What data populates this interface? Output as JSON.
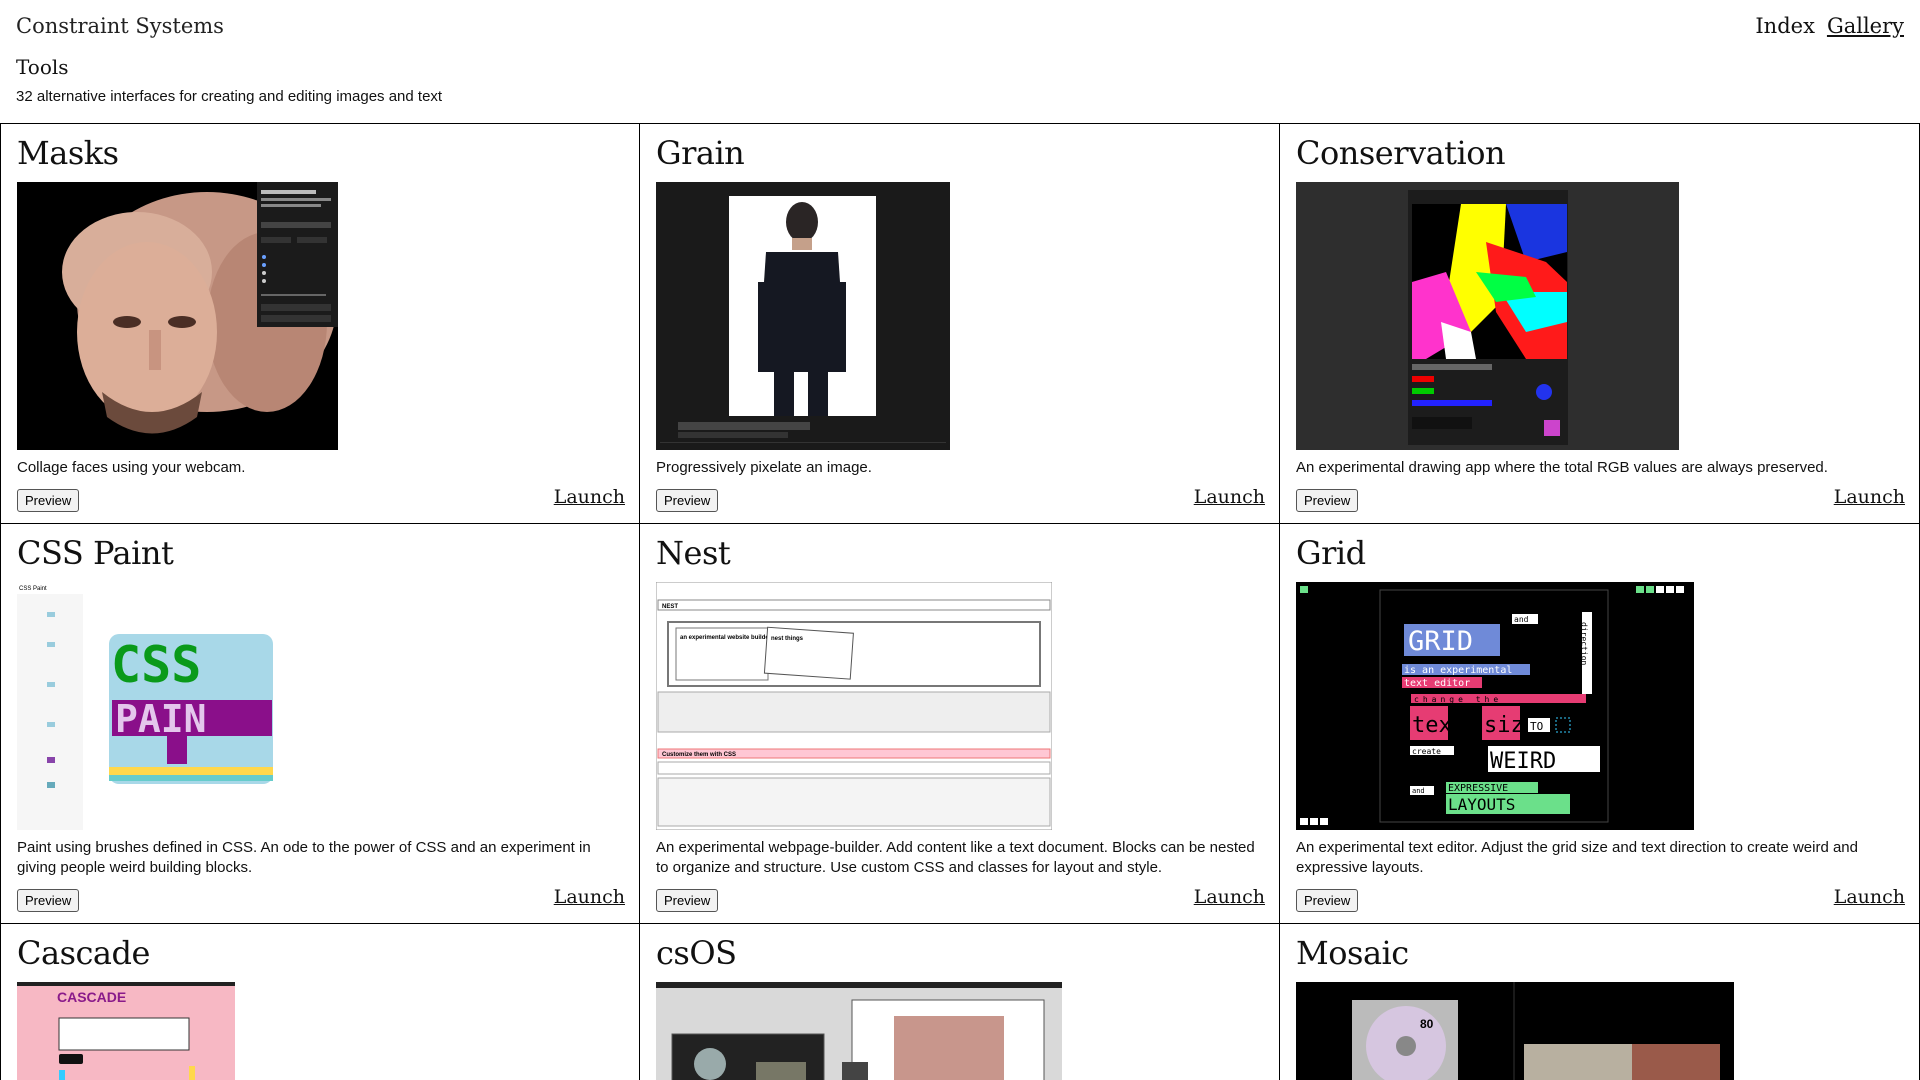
{
  "site": {
    "title": "Constraint Systems"
  },
  "nav": {
    "index": "Index",
    "gallery": "Gallery"
  },
  "section": {
    "title": "Tools",
    "subtitle": "32 alternative interfaces for creating and editing images and text"
  },
  "cards": [
    {
      "title": "Masks",
      "desc": "Collage faces using your webcam.",
      "preview": "Preview",
      "launch": "Launch"
    },
    {
      "title": "Grain",
      "desc": "Progressively pixelate an image.",
      "preview": "Preview",
      "launch": "Launch"
    },
    {
      "title": "Conservation",
      "desc": "An experimental drawing app where the total RGB values are always preserved.",
      "preview": "Preview",
      "launch": "Launch"
    },
    {
      "title": "CSS Paint",
      "desc": "Paint using brushes defined in CSS. An ode to the power of CSS and an experiment in giving people weird building blocks.",
      "preview": "Preview",
      "launch": "Launch"
    },
    {
      "title": "Nest",
      "desc": "An experimental webpage-builder. Add content like a text document. Blocks can be nested to organize and structure. Use custom CSS and classes for layout and style.",
      "preview": "Preview",
      "launch": "Launch"
    },
    {
      "title": "Grid",
      "desc": "An experimental text editor. Adjust the grid size and text direction to create weird and expressive layouts.",
      "preview": "Preview",
      "launch": "Launch"
    },
    {
      "title": "Cascade"
    },
    {
      "title": "csOS"
    },
    {
      "title": "Mosaic"
    }
  ],
  "thumb_text": {
    "grid_word1": "GRID",
    "grid_word2": "is an experimental",
    "grid_word3": "text editor",
    "grid_word4": "text",
    "grid_word5": "size",
    "grid_word6": "TO",
    "grid_word7": "WEIRD",
    "grid_word8": "EXPRESSIVE",
    "grid_word9": "LAYOUTS",
    "grid_small1": "and",
    "grid_small2": "change the",
    "grid_small3": "create",
    "grid_small4": "and",
    "grid_vertical": "direction",
    "css_line1": "CSS",
    "css_line2": "PAIN",
    "cascade_title": "CASCADE",
    "nest_title": "NEST",
    "nest_block": "an experimental website builder",
    "nest_nest": "nest things",
    "nest_css": "Customize them with CSS",
    "cssp_title": "CSS Paint",
    "mosaic_num": "80"
  }
}
